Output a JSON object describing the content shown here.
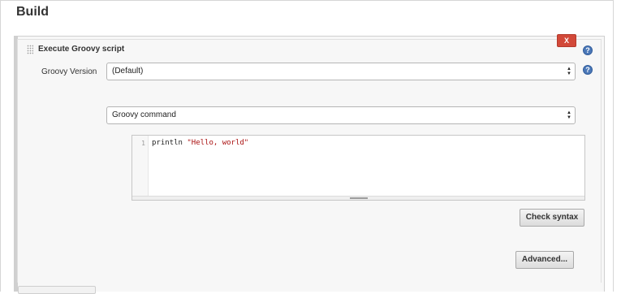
{
  "section": {
    "title": "Build"
  },
  "step": {
    "title": "Execute Groovy script",
    "delete_label": "X"
  },
  "groovy_version": {
    "label": "Groovy Version",
    "selected": "(Default)"
  },
  "script_source": {
    "selected": "Groovy command"
  },
  "editor": {
    "line_number": "1",
    "code_keyword": "println",
    "code_string": "\"Hello, world\""
  },
  "buttons": {
    "check_syntax": "Check syntax",
    "advanced": "Advanced..."
  },
  "icons": {
    "help": "help-icon",
    "drag": "drag-handle-icon",
    "select_arrows": "select-arrows-icon"
  },
  "colors": {
    "delete_red": "#d24939",
    "help_blue": "#4b78b8",
    "code_string": "#aa1111"
  }
}
